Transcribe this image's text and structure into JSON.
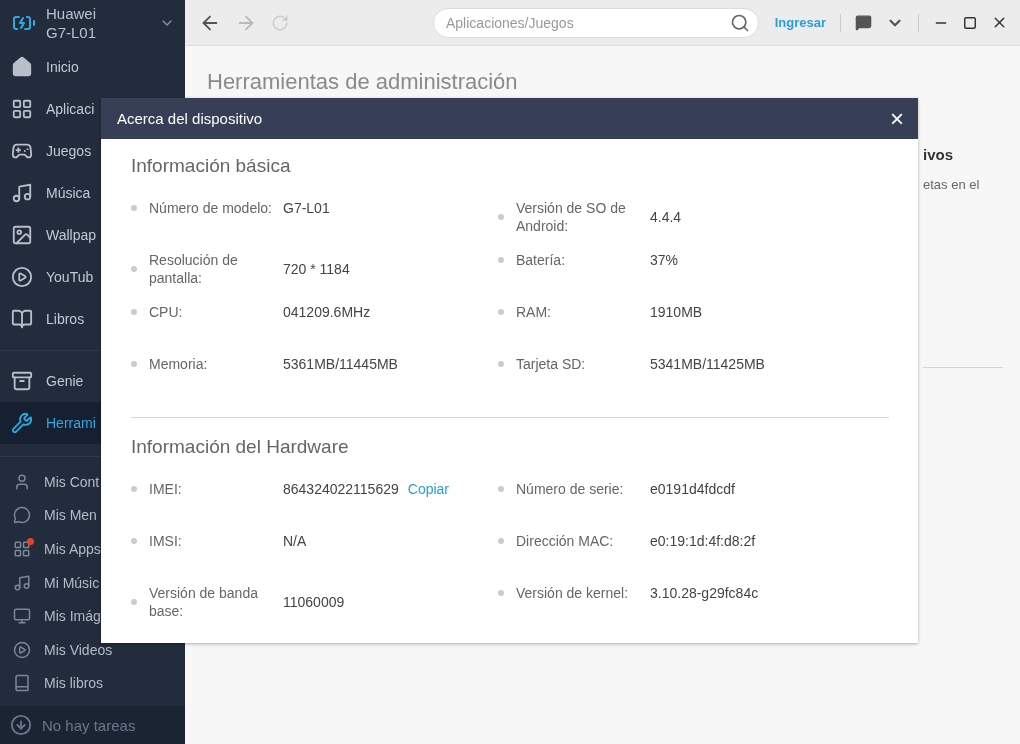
{
  "sidebar": {
    "device": {
      "name": "Huawei",
      "model": "G7-L01"
    },
    "main_items": [
      {
        "label": "Inicio",
        "selected": false
      },
      {
        "label": "Aplicaci",
        "selected": false
      },
      {
        "label": "Juegos",
        "selected": false
      },
      {
        "label": "Música",
        "selected": false
      },
      {
        "label": "Wallpap",
        "selected": false
      },
      {
        "label": "YouTub",
        "selected": false
      },
      {
        "label": "Libros",
        "selected": false
      }
    ],
    "tool_items": [
      {
        "label": "Genie",
        "selected": false
      },
      {
        "label": "Herrami",
        "selected": true
      }
    ],
    "my_items": [
      {
        "label": "Mis Cont",
        "notification": false
      },
      {
        "label": "Mis Men",
        "notification": false
      },
      {
        "label": "Mis Apps",
        "notification": true
      },
      {
        "label": "Mi Músic",
        "notification": false
      },
      {
        "label": "Mis Imág",
        "notification": false
      },
      {
        "label": "Mis Videos",
        "notification": false
      },
      {
        "label": "Mis libros",
        "notification": false
      }
    ],
    "tasks": "No hay tareas"
  },
  "toolbar": {
    "search": {
      "placeholder": "Aplicaciones/Juegos"
    },
    "login": "Ingresar"
  },
  "page": {
    "title": "Herramientas de administración",
    "side_heading": "ivos",
    "side_text": "etas en el"
  },
  "dialog": {
    "title": "Acerca del dispositivo",
    "close": "×",
    "sections": [
      {
        "heading": "Información básica",
        "items": [
          {
            "label": "Número de modelo:",
            "value": "G7-L01"
          },
          {
            "label": "Versión de SO de Android:",
            "value": "4.4.4"
          },
          {
            "label": "Resolución de pantalla:",
            "value": "720 * 1184"
          },
          {
            "label": "Batería:",
            "value": "37%"
          },
          {
            "label": "CPU:",
            "value": "041209.6MHz"
          },
          {
            "label": "RAM:",
            "value": "1910MB"
          },
          {
            "label": "Memoria:",
            "value": "5361MB/11445MB"
          },
          {
            "label": "Tarjeta SD:",
            "value": "5341MB/11425MB"
          }
        ]
      },
      {
        "heading": "Información del Hardware",
        "items": [
          {
            "label": "IMEI:",
            "value": "864324022115629",
            "action": "Copiar"
          },
          {
            "label": "Número de serie:",
            "value": "e0191d4fdcdf"
          },
          {
            "label": "IMSI:",
            "value": "N/A"
          },
          {
            "label": "Dirección MAC:",
            "value": "e0:19:1d:4f:d8:2f"
          },
          {
            "label": "Versión de banda base:",
            "value": "11060009"
          },
          {
            "label": "Versión de kernel:",
            "value": "3.10.28-g29fc84c"
          }
        ]
      }
    ]
  }
}
